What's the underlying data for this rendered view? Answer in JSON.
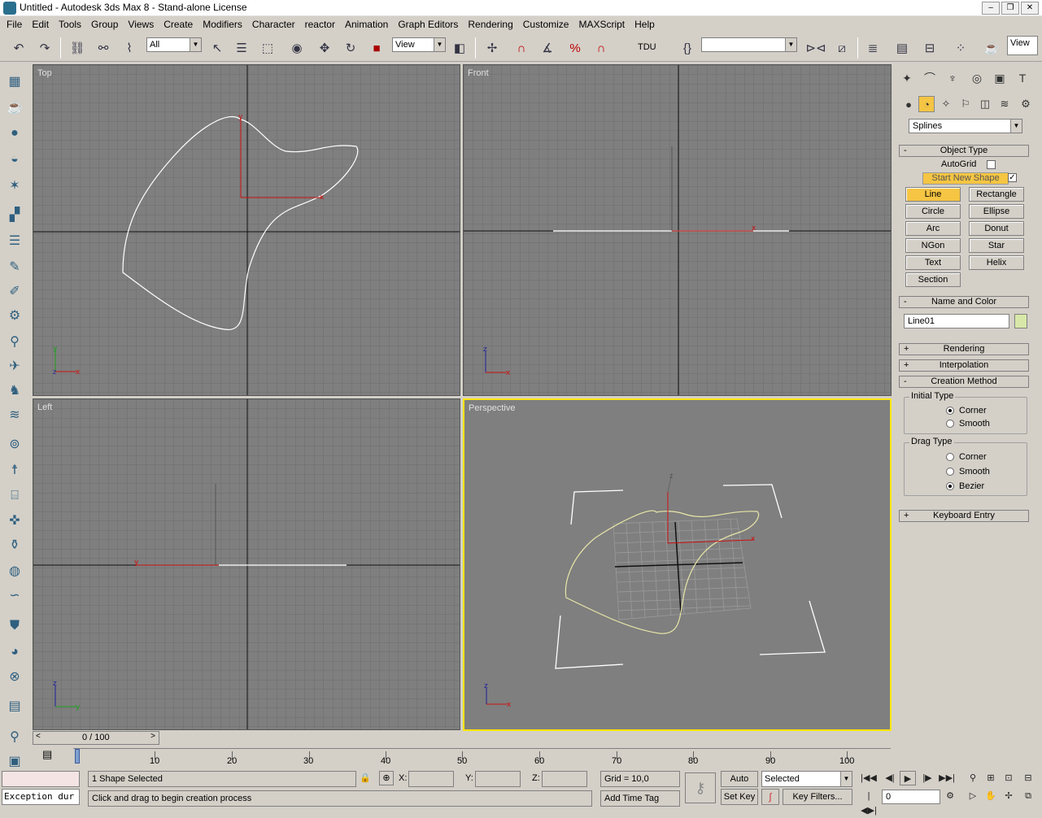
{
  "window": {
    "title": "Untitled - Autodesk 3ds Max 8  - Stand-alone License",
    "buttons": [
      "–",
      "❐",
      "✕"
    ]
  },
  "menu": [
    "File",
    "Edit",
    "Tools",
    "Group",
    "Views",
    "Create",
    "Modifiers",
    "Character",
    "reactor",
    "Animation",
    "Graph Editors",
    "Rendering",
    "Customize",
    "MAXScript",
    "Help"
  ],
  "toolbar": {
    "selection_filter": "All",
    "ref_coord": "View",
    "tdu": "TDU",
    "named_sel": "",
    "view_btn": "View"
  },
  "viewports": {
    "top": "Top",
    "front": "Front",
    "left": "Left",
    "perspective": "Perspective"
  },
  "command_panel": {
    "category": "Splines",
    "object_type": {
      "title": "Object Type",
      "autogrid": "AutoGrid",
      "start_new_shape": "Start New Shape",
      "buttons": [
        "Line",
        "Rectangle",
        "Circle",
        "Ellipse",
        "Arc",
        "Donut",
        "NGon",
        "Star",
        "Text",
        "Helix",
        "Section"
      ]
    },
    "name_and_color": {
      "title": "Name and Color",
      "name": "Line01",
      "color": "#d8e8a8"
    },
    "rendering": "Rendering",
    "interpolation": "Interpolation",
    "creation_method": {
      "title": "Creation Method",
      "initial_type": "Initial Type",
      "initial_options": [
        "Corner",
        "Smooth"
      ],
      "initial_selected": "Corner",
      "drag_type": "Drag Type",
      "drag_options": [
        "Corner",
        "Smooth",
        "Bezier"
      ],
      "drag_selected": "Bezier"
    },
    "keyboard_entry": "Keyboard Entry"
  },
  "timeline": {
    "slider": "0 / 100",
    "ticks": [
      "10",
      "20",
      "30",
      "40",
      "50",
      "60",
      "70",
      "80",
      "90",
      "100"
    ]
  },
  "status": {
    "selection": "1 Shape Selected",
    "prompt": "Click and drag to begin creation process",
    "x_label": "X:",
    "y_label": "Y:",
    "z_label": "Z:",
    "grid": "Grid = 10,0",
    "add_time_tag": "Add Time Tag",
    "auto_key": "Auto Key",
    "set_key": "Set Key",
    "key_filter": "Selected",
    "key_filters_btn": "Key Filters...",
    "frame": "0",
    "maxscript": "Exception dur"
  }
}
